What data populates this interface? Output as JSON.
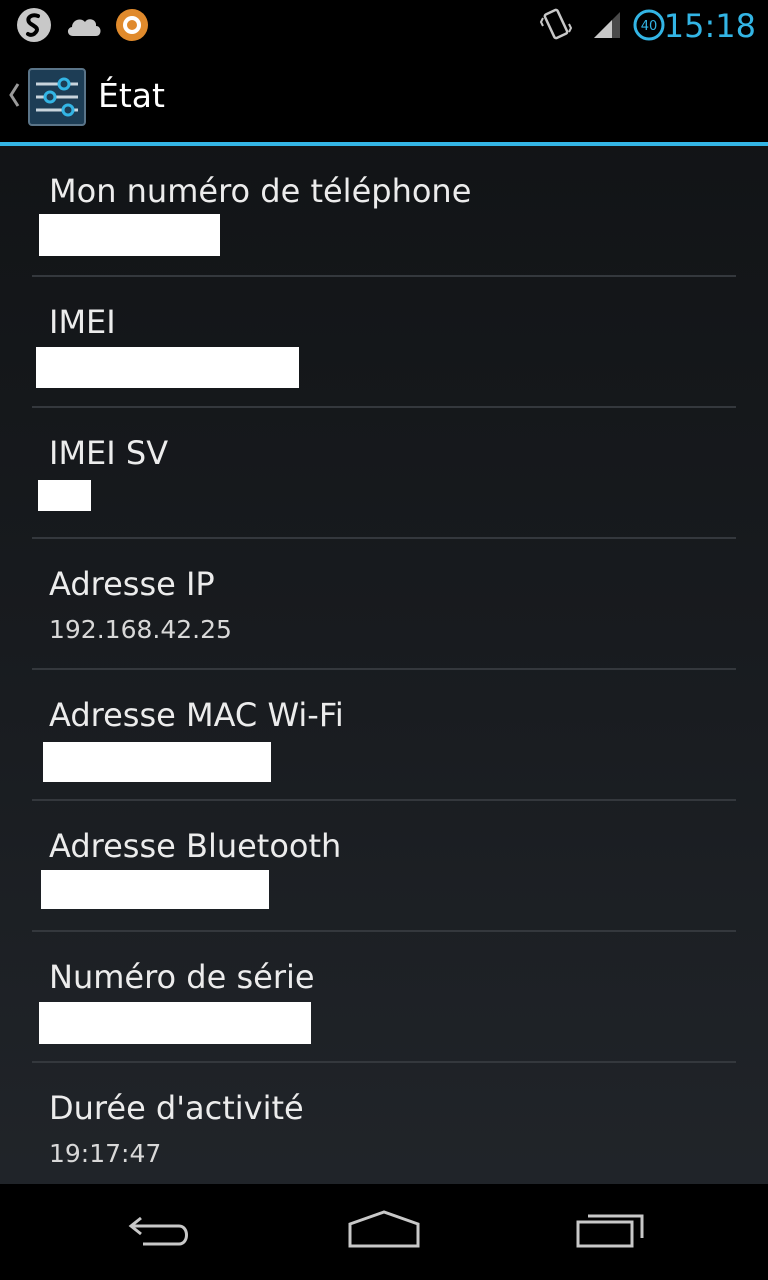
{
  "status_bar": {
    "icons": [
      "shazam-icon",
      "cloud-icon",
      "avast-icon",
      "vibrate-icon",
      "signal-icon",
      "battery-icon"
    ],
    "battery_level": "40",
    "time": "15:18",
    "accent_color": "#33b5e5"
  },
  "action_bar": {
    "title": "État",
    "icon": "settings-sliders-icon",
    "up_icon": "chevron-left-icon"
  },
  "items": [
    {
      "title": "Mon numéro de téléphone",
      "summary": ""
    },
    {
      "title": "IMEI",
      "summary": ""
    },
    {
      "title": "IMEI SV",
      "summary": ""
    },
    {
      "title": "Adresse IP",
      "summary": "192.168.42.25"
    },
    {
      "title": "Adresse MAC Wi-Fi",
      "summary": ""
    },
    {
      "title": "Adresse Bluetooth",
      "summary": ""
    },
    {
      "title": "Numéro de série",
      "summary": ""
    },
    {
      "title": "Durée d'activité",
      "summary": "19:17:47"
    }
  ],
  "nav_bar": {
    "buttons": [
      "back-icon",
      "home-icon",
      "recent-apps-icon"
    ]
  }
}
